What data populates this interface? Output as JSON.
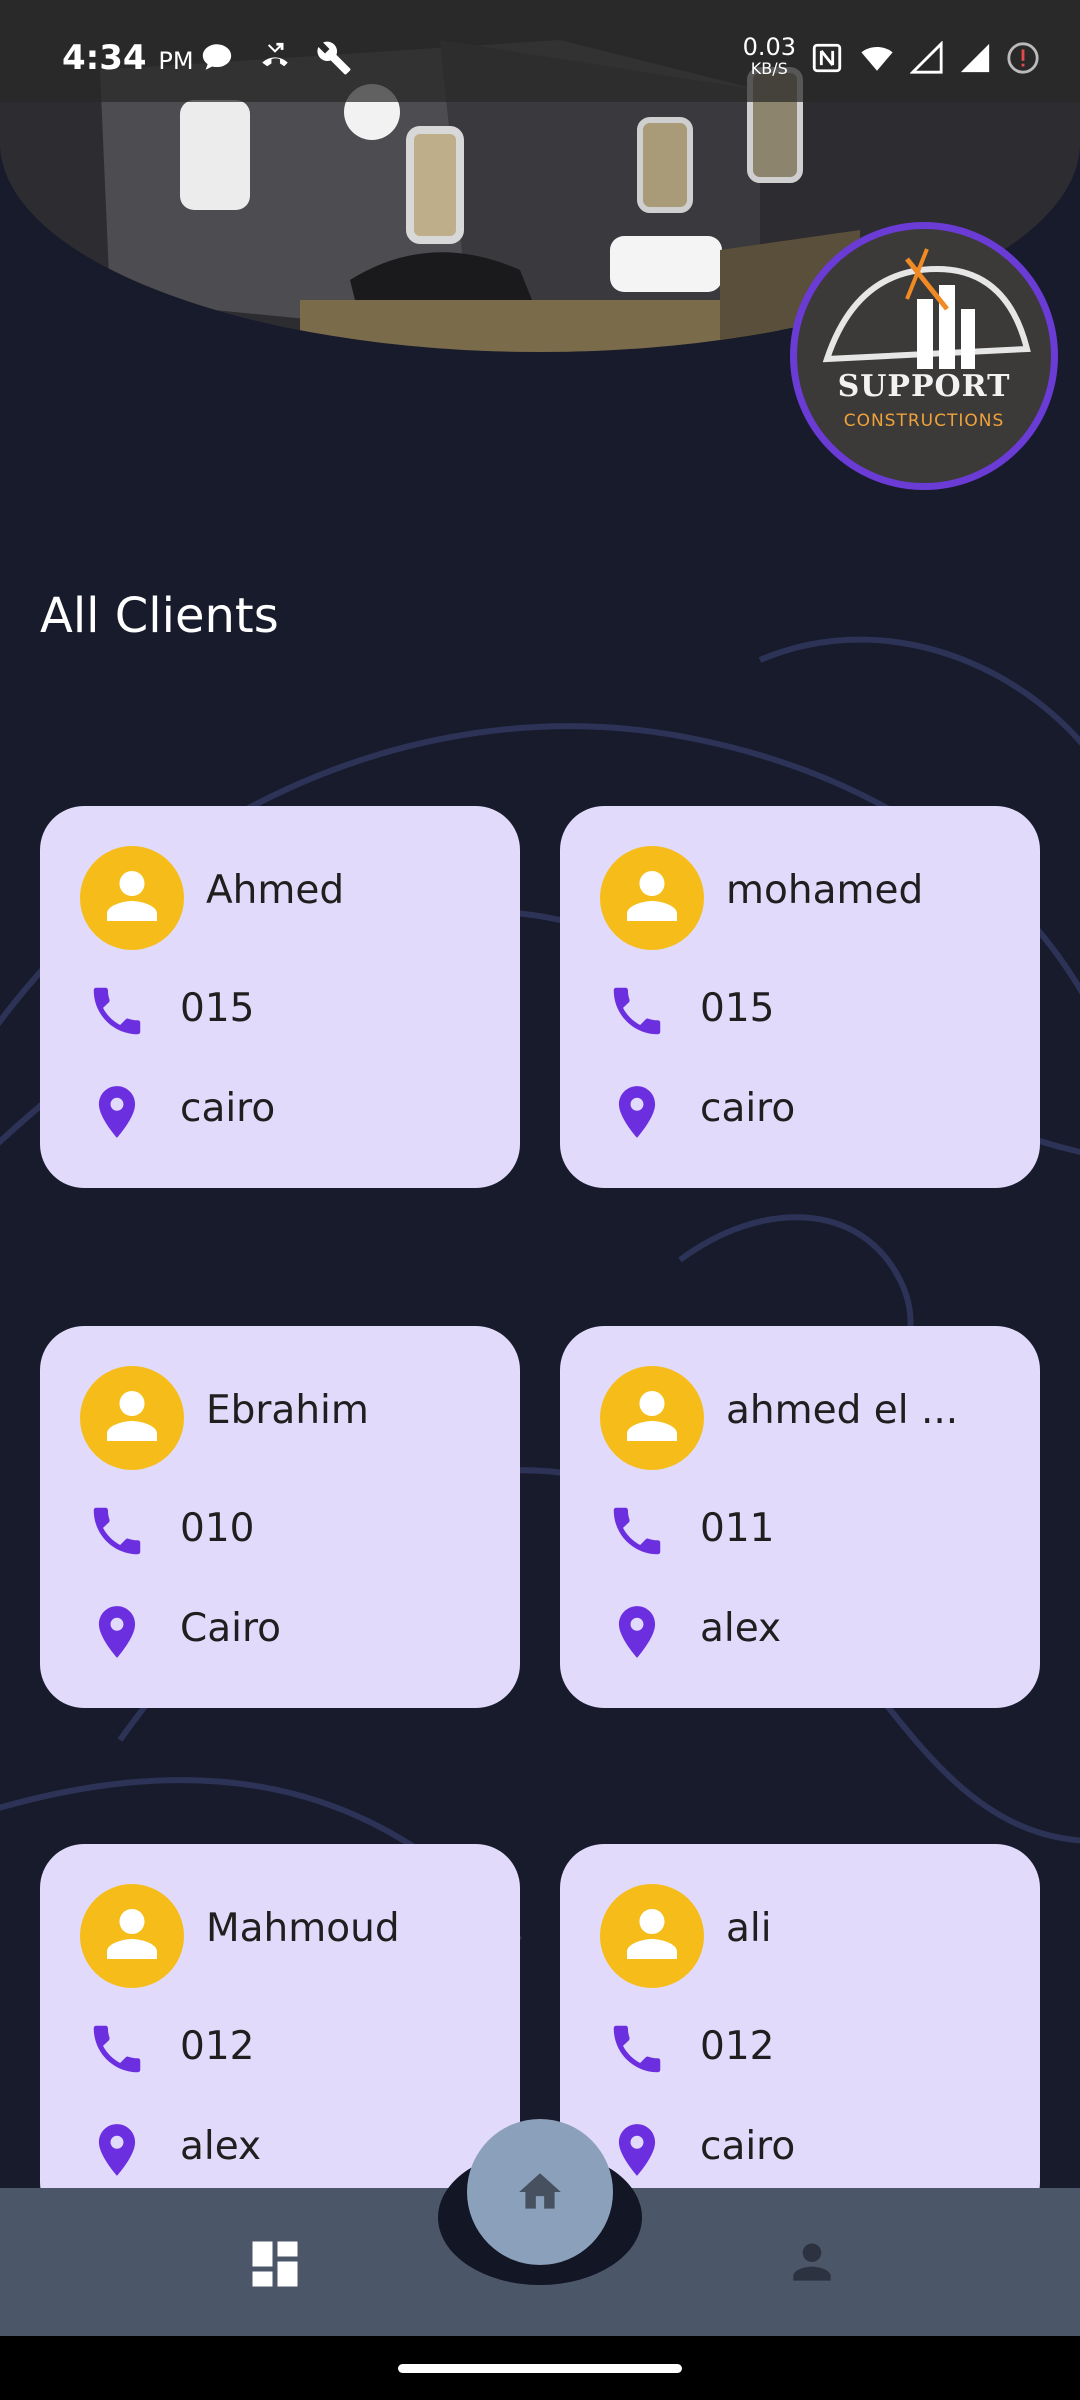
{
  "status_bar": {
    "time": "4:34",
    "ampm": "PM",
    "net_speed_value": "0.03",
    "net_speed_unit": "KB/S",
    "icons": [
      "chat-bubble-icon",
      "missed-call-icon",
      "wrench-icon",
      "nfc-icon",
      "wifi-icon",
      "signal-icon",
      "signal-icon",
      "alert-icon"
    ]
  },
  "logo": {
    "word1": "SUPPORT",
    "word2": "CONSTRUCTIONS"
  },
  "page": {
    "title": "All Clients"
  },
  "clients": [
    {
      "name": "Ahmed",
      "phone": "015",
      "city": "cairo"
    },
    {
      "name": "mohamed",
      "phone": "015",
      "city": "cairo"
    },
    {
      "name": "Ebrahim",
      "phone": "010",
      "city": "Cairo"
    },
    {
      "name": "ahmed el ...",
      "phone": "011",
      "city": "alex"
    },
    {
      "name": "Mahmoud",
      "phone": "012",
      "city": "alex"
    },
    {
      "name": "ali",
      "phone": "012",
      "city": "cairo"
    }
  ],
  "bottom_nav": {
    "items": [
      "dashboard-icon",
      "home-icon",
      "person-icon"
    ],
    "active": "home-icon"
  },
  "colors": {
    "background": "#171b2b",
    "card": "#e2dafb",
    "avatar": "#f6bd1a",
    "accent_purple": "#6b2fe0",
    "nav": "#4b5668",
    "fab": "#8aa0bb"
  }
}
